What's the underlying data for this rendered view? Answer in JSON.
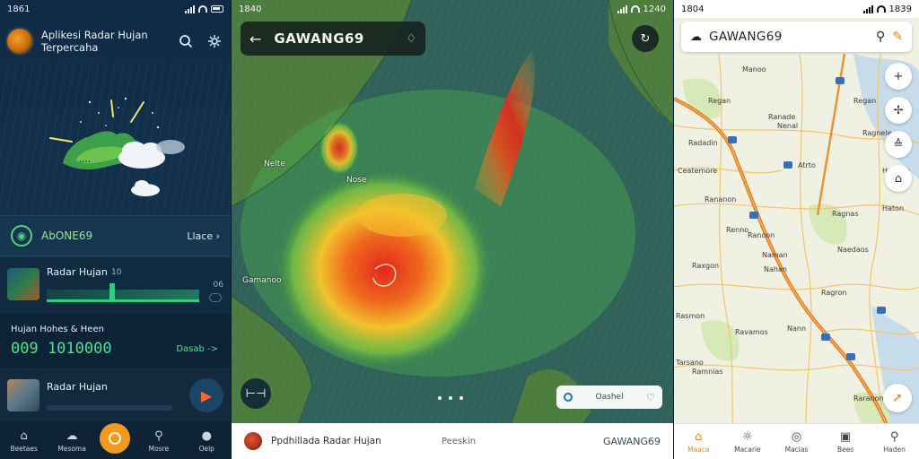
{
  "panel1": {
    "status": {
      "time": "1861"
    },
    "header": {
      "title": "Aplikesi Radar Hujan Terpercaha",
      "search_icon": "search-icon",
      "menu_icon": "settings-icon"
    },
    "location_row": {
      "name": "AbONE69",
      "more": "Llace",
      "chevron": "›"
    },
    "radar_row": {
      "label": "Radar Hujan",
      "value": "10",
      "value2": "06"
    },
    "stats_row": {
      "title": "Hujan Hohes & Heen",
      "number": "009 1010000",
      "link": "Dasab ->"
    },
    "player_row": {
      "label": "Radar Hujan"
    },
    "nav": [
      {
        "label": "Beetaes",
        "icon": "home-icon"
      },
      {
        "label": "Mesoma",
        "icon": "cloud-icon"
      },
      {
        "label": "",
        "icon": "radar-icon"
      },
      {
        "label": "Mosre",
        "icon": "search-icon"
      },
      {
        "label": "Oelp",
        "icon": "profile-icon"
      }
    ]
  },
  "panel2": {
    "status": {
      "time": "1840",
      "right": "1240"
    },
    "topbar": {
      "title": "GAWANG69"
    },
    "labels": {
      "a": "Nelte",
      "b": "Nose",
      "c": "Gamanoo"
    },
    "legend": {
      "text": "Oashel"
    },
    "bottom": {
      "brand": "Ppdhillada Radar Hujan",
      "mid": "Peeskin",
      "right": "GAWANG69"
    }
  },
  "panel3": {
    "status": {
      "time": "1804",
      "right": "1839"
    },
    "search": {
      "title": "GAWANG69"
    },
    "labels": [
      "Manoo",
      "Regan",
      "Regan",
      "Ranade",
      "Nenal",
      "Radadin",
      "Ragnele",
      "Ceatemore",
      "Atrto",
      "Haimon",
      "Rananon",
      "Ragnas",
      "Renno",
      "Haton",
      "Ranoon",
      "Naman",
      "Raxgon",
      "Naedaos",
      "Nahan",
      "Ragron",
      "Rasmon",
      "Ravamos",
      "Tarsano",
      "Ramnias",
      "Nann",
      "Raranon",
      "Heaton"
    ],
    "nav": [
      {
        "label": "Maaca",
        "icon": "home-icon"
      },
      {
        "label": "Macarie",
        "icon": "weather-icon"
      },
      {
        "label": "Macias",
        "icon": "globe-icon"
      },
      {
        "label": "Bees",
        "icon": "calendar-icon"
      },
      {
        "label": "Haden",
        "icon": "search-icon"
      }
    ]
  }
}
